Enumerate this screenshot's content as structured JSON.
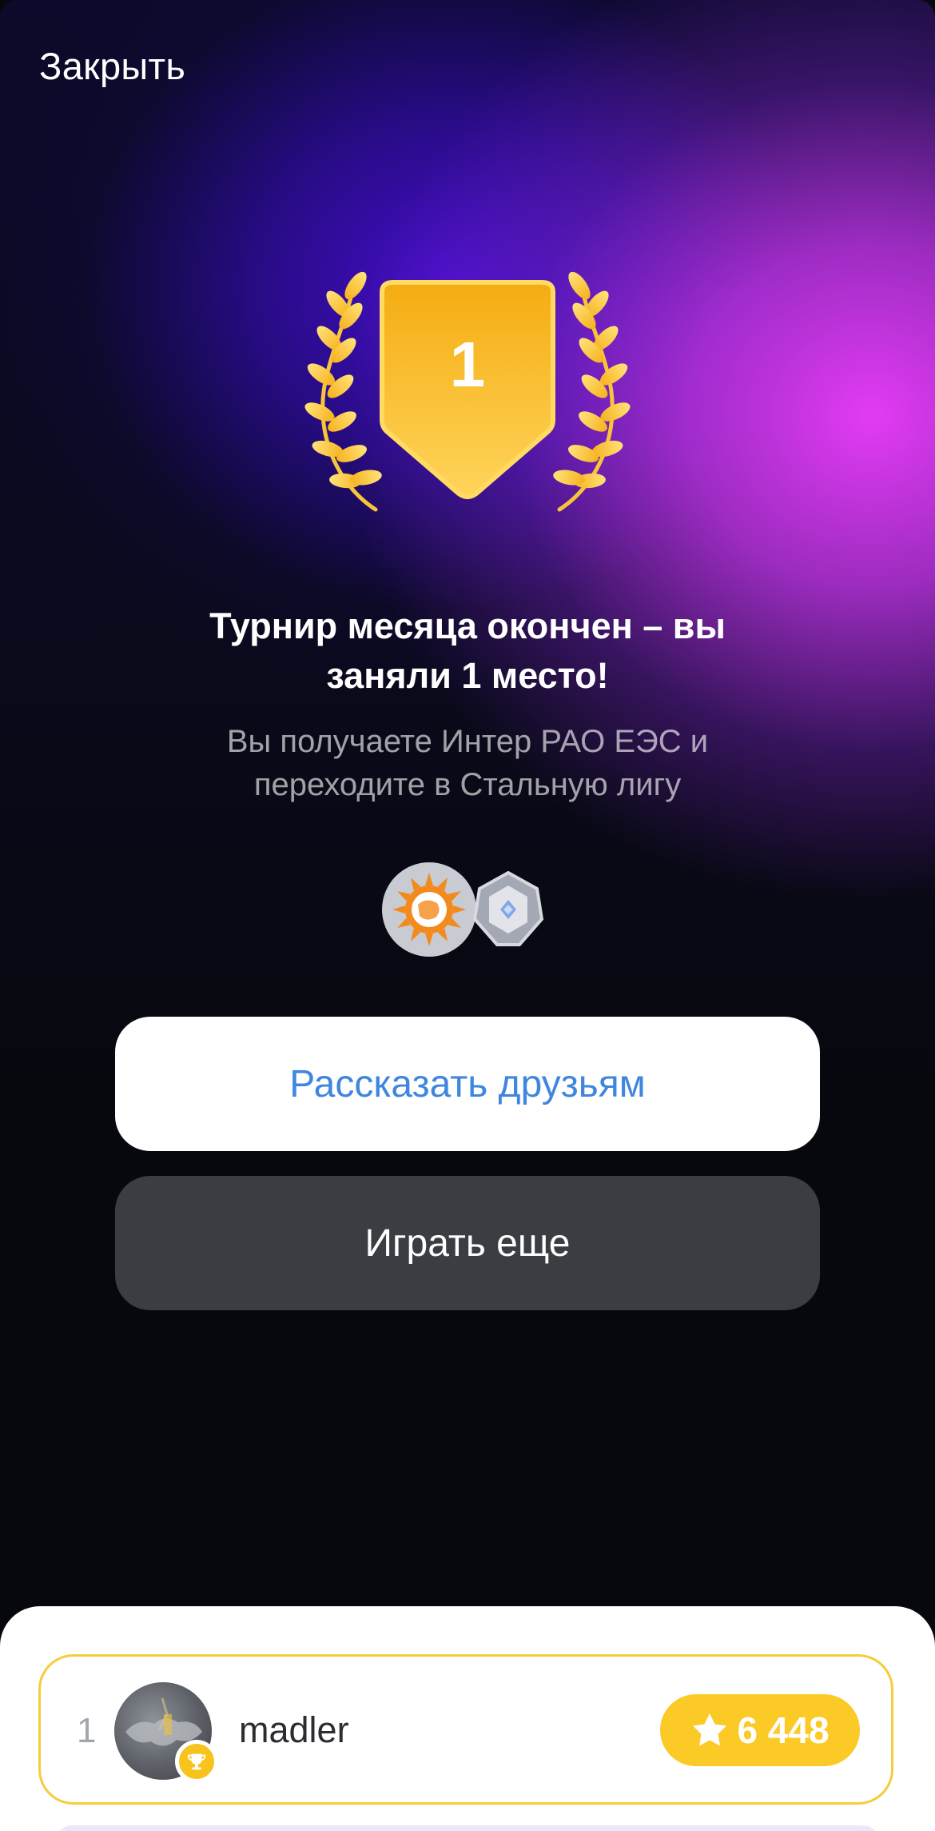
{
  "header": {
    "close_label": "Закрыть"
  },
  "award": {
    "place_number": "1",
    "icon": "laurel-shield-icon"
  },
  "result": {
    "title_line1": "Турнир месяца окончен – вы",
    "title_line2": "заняли 1 место!",
    "subtitle_line1": "Вы получаете Интер РАО ЕЭС и",
    "subtitle_line2": "переходите в Стальную лигу"
  },
  "rewards": {
    "company_icon": "inter-rao-logo-icon",
    "league_icon": "steel-league-badge-icon"
  },
  "actions": {
    "share_label": "Рассказать друзьям",
    "play_again_label": "Играть еще"
  },
  "leaderboard": {
    "rows": [
      {
        "rank": "1",
        "username": "madler",
        "score": "6 448",
        "score_icon": "star-icon",
        "badge_icon": "trophy-icon"
      }
    ]
  },
  "colors": {
    "accent_blue": "#3f86de",
    "gold": "#fcca26",
    "button_dark": "#3a3d42",
    "gradient_purple": "#4a0fd2",
    "gradient_magenta": "#ee3eff"
  }
}
